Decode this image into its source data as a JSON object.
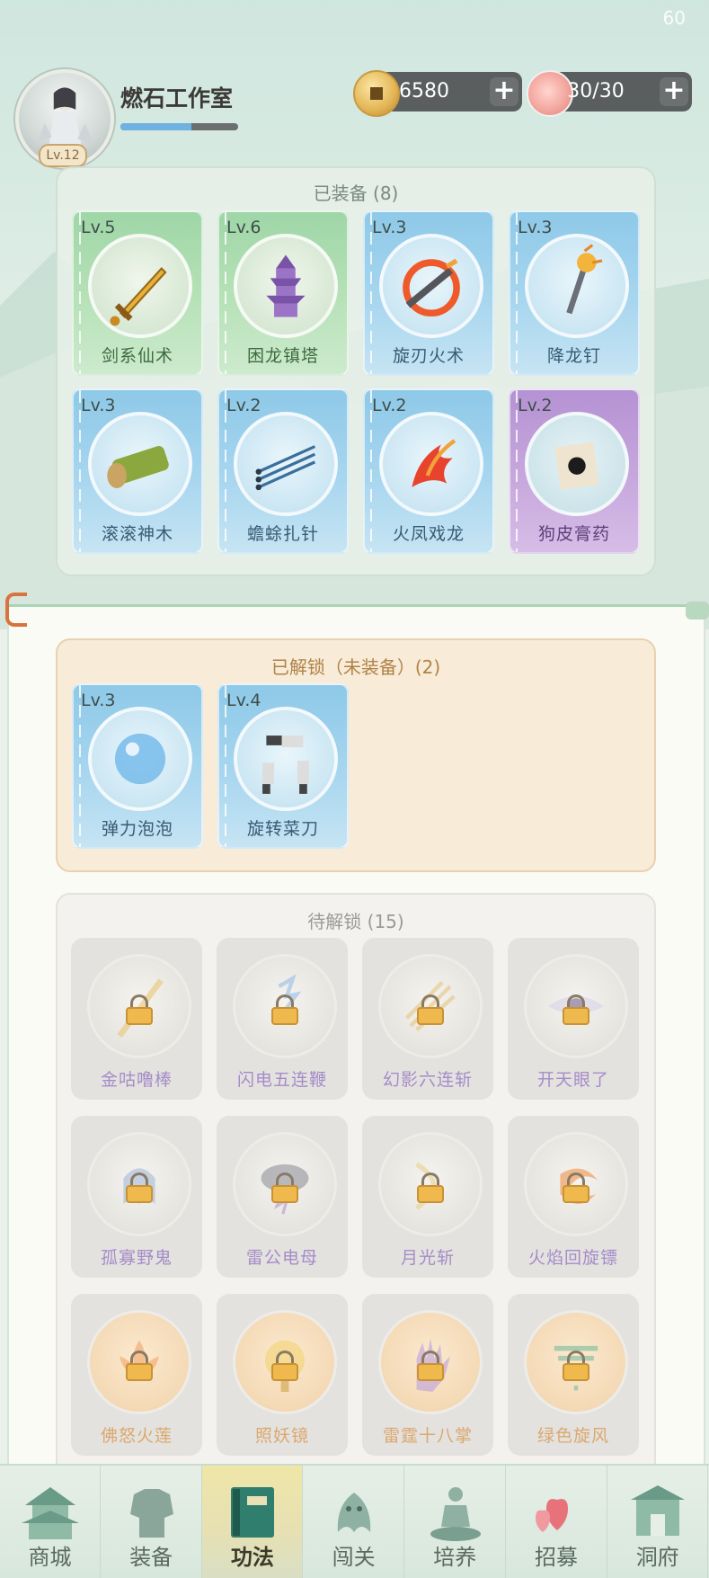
{
  "status": {
    "fps": "60"
  },
  "player": {
    "name": "燃石工作室",
    "level": "Lv.12",
    "exp_progress": 0.6
  },
  "currencies": {
    "coins": {
      "icon": "copper-coin-icon",
      "value": "6580"
    },
    "stamina": {
      "icon": "peach-icon",
      "value": "30/30"
    }
  },
  "equipped": {
    "title": "已装备 (8)",
    "cards": [
      {
        "level": "Lv.5",
        "name": "剑系仙术",
        "color": "green",
        "icon": "golden-sword-icon"
      },
      {
        "level": "Lv.6",
        "name": "困龙镇塔",
        "color": "green",
        "icon": "pagoda-icon"
      },
      {
        "level": "Lv.3",
        "name": "旋刃火术",
        "color": "blue",
        "icon": "fire-ring-blade-icon"
      },
      {
        "level": "Lv.3",
        "name": "降龙钉",
        "color": "blue",
        "icon": "golden-nail-icon"
      },
      {
        "level": "Lv.3",
        "name": "滚滚神木",
        "color": "blue",
        "icon": "wood-log-icon"
      },
      {
        "level": "Lv.2",
        "name": "蟾蜍扎针",
        "color": "blue",
        "icon": "needles-icon"
      },
      {
        "level": "Lv.2",
        "name": "火凤戏龙",
        "color": "blue",
        "icon": "phoenix-icon"
      },
      {
        "level": "Lv.2",
        "name": "狗皮膏药",
        "color": "purple",
        "icon": "plaster-icon"
      }
    ]
  },
  "unlocked": {
    "title": "已解锁（未装备）(2)",
    "cards": [
      {
        "level": "Lv.3",
        "name": "弹力泡泡",
        "color": "blue",
        "icon": "bubble-icon"
      },
      {
        "level": "Lv.4",
        "name": "旋转菜刀",
        "color": "blue",
        "icon": "cleavers-icon"
      }
    ]
  },
  "pending": {
    "title": "待解锁 (15)",
    "cards": [
      {
        "name": "金咕噜棒",
        "tone": "purple",
        "icon": "staff-icon"
      },
      {
        "name": "闪电五连鞭",
        "tone": "purple",
        "icon": "lightning-whip-icon"
      },
      {
        "name": "幻影六连斩",
        "tone": "purple",
        "icon": "phantom-slash-icon"
      },
      {
        "name": "开天眼了",
        "tone": "purple",
        "icon": "eye-icon"
      },
      {
        "name": "孤寡野鬼",
        "tone": "purple",
        "icon": "ghost-icon"
      },
      {
        "name": "雷公电母",
        "tone": "purple",
        "icon": "thundercloud-icon"
      },
      {
        "name": "月光斩",
        "tone": "purple",
        "icon": "moon-slash-icon"
      },
      {
        "name": "火焰回旋镖",
        "tone": "purple",
        "icon": "flame-boomerang-icon"
      },
      {
        "name": "佛怒火莲",
        "tone": "orange",
        "icon": "fire-lotus-icon"
      },
      {
        "name": "照妖镜",
        "tone": "orange",
        "icon": "mirror-icon"
      },
      {
        "name": "雷霆十八掌",
        "tone": "orange",
        "icon": "thunder-palm-icon"
      },
      {
        "name": "绿色旋风",
        "tone": "orange",
        "icon": "tornado-icon"
      }
    ]
  },
  "nav": {
    "items": [
      {
        "label": "商城",
        "icon": "palace-icon",
        "active": false
      },
      {
        "label": "装备",
        "icon": "armor-icon",
        "active": false
      },
      {
        "label": "功法",
        "icon": "book-icon",
        "active": true
      },
      {
        "label": "闯关",
        "icon": "dragon-icon",
        "active": false
      },
      {
        "label": "培养",
        "icon": "meditating-figure-icon",
        "active": false
      },
      {
        "label": "招募",
        "icon": "hearts-icon",
        "active": false
      },
      {
        "label": "洞府",
        "icon": "gate-pavilion-icon",
        "active": false
      }
    ]
  }
}
